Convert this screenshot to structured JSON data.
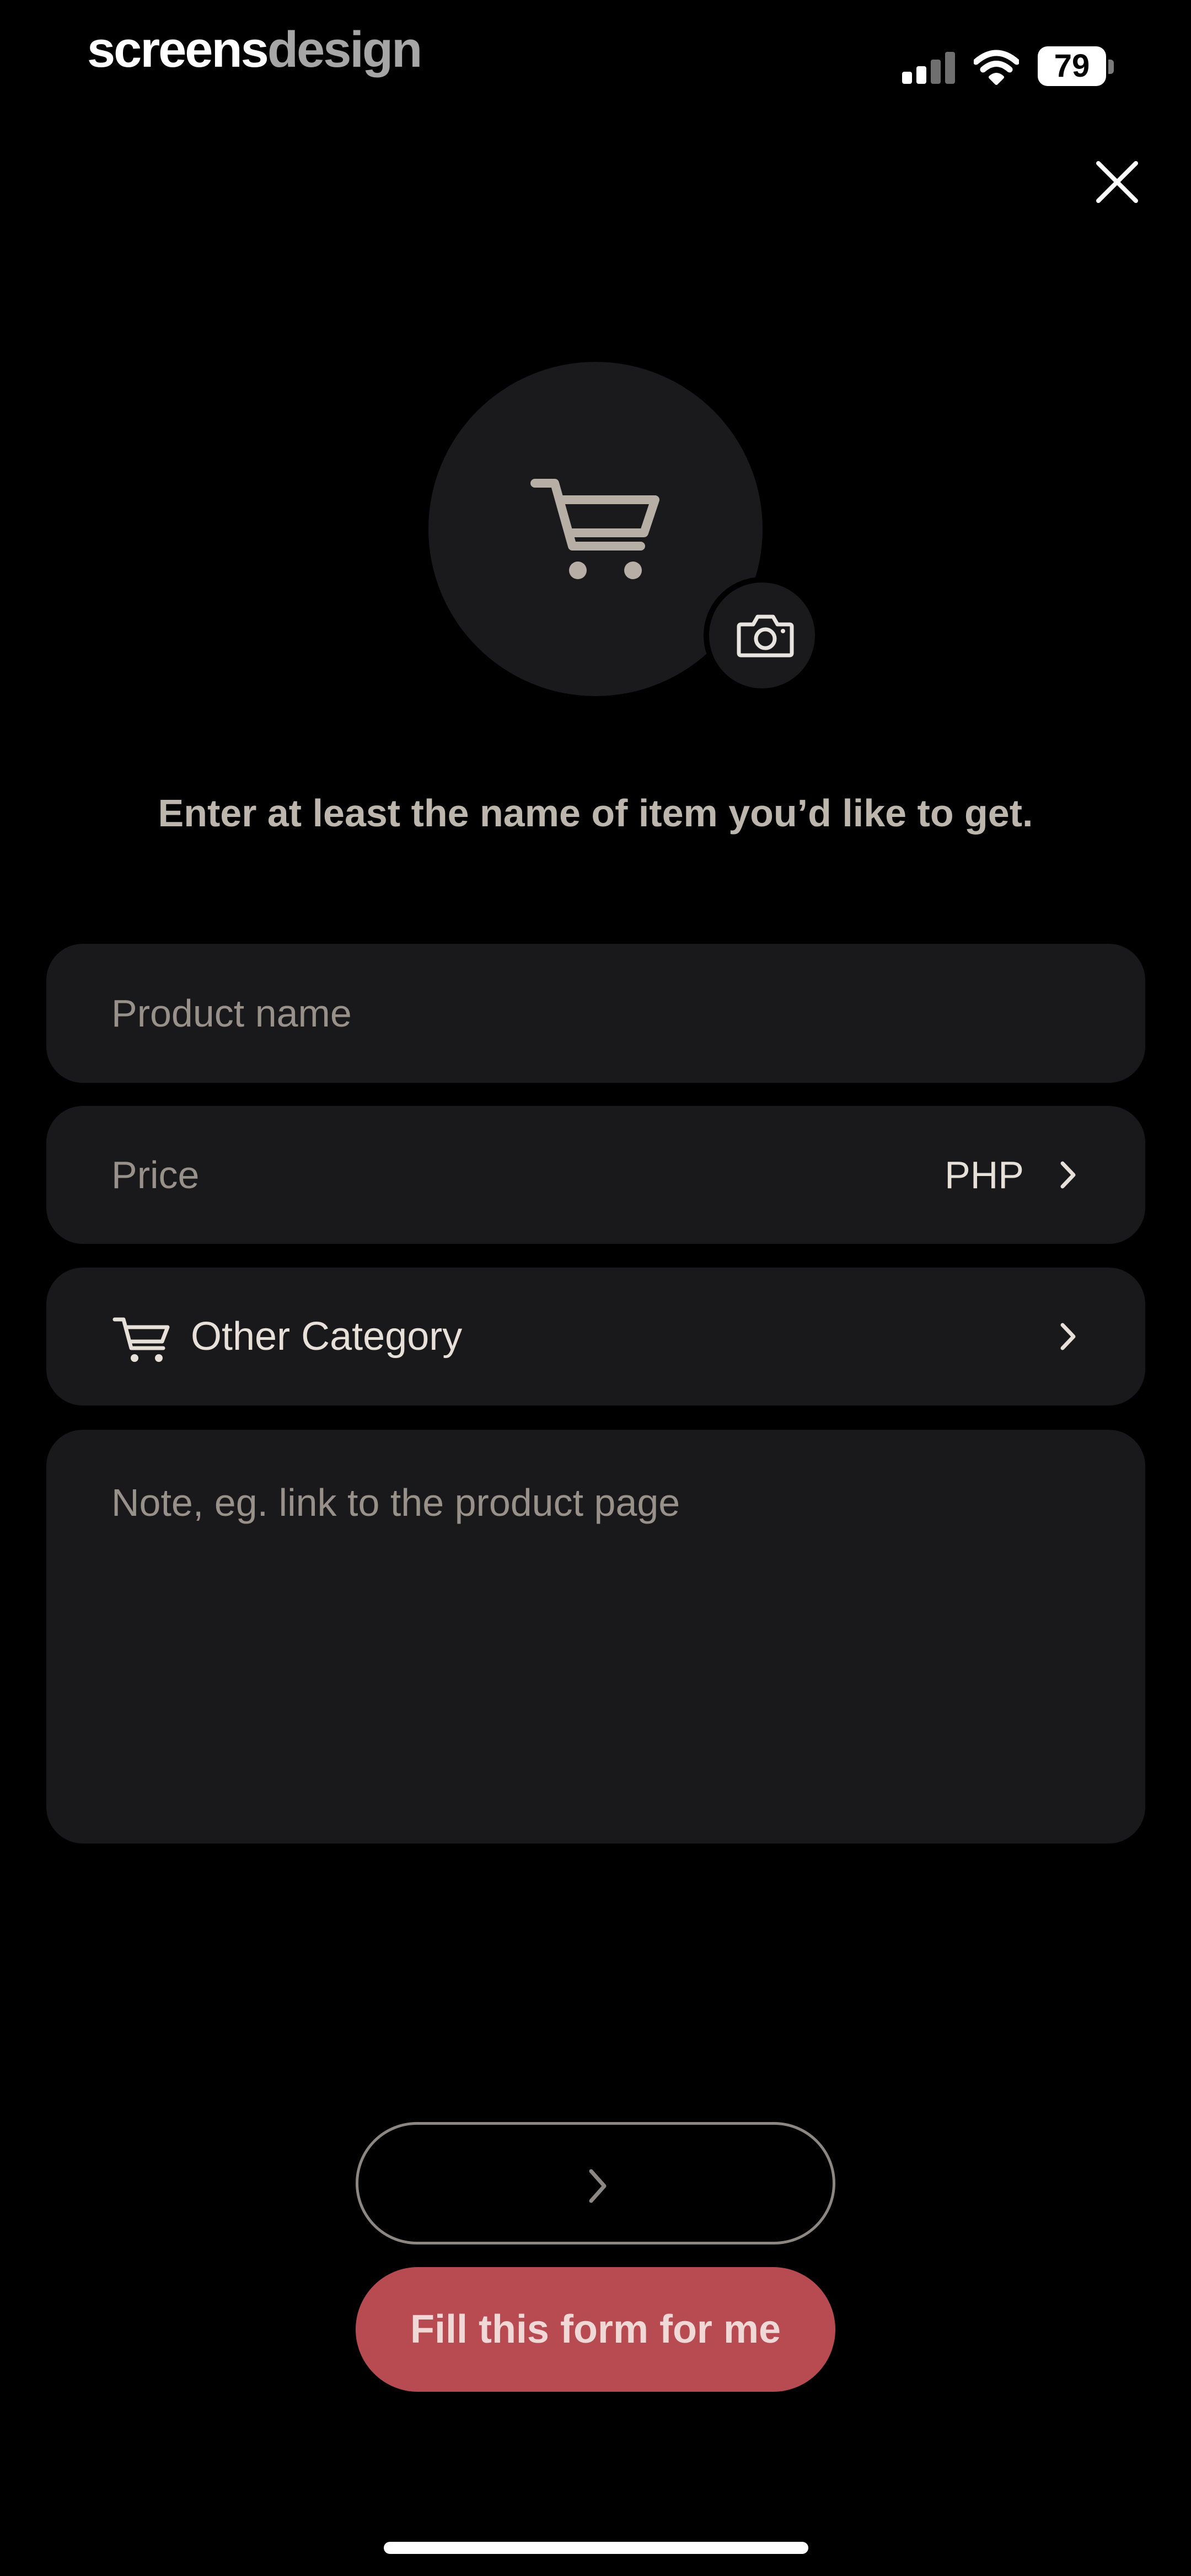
{
  "status_bar": {
    "brand_part1": "screens",
    "brand_part2": "design",
    "battery": "79"
  },
  "icons": {
    "close": "close-icon",
    "cart": "cart-icon",
    "camera": "camera-icon",
    "chevron": "chevron-right-icon"
  },
  "prompt": "Enter at least the name of item you’d like to get.",
  "form": {
    "product_name_placeholder": "Product name",
    "price_placeholder": "Price",
    "currency": "PHP",
    "category_label": "Other Category",
    "note_placeholder": "Note, eg. link to the product page"
  },
  "buttons": {
    "fill_form_label": "Fill this form for me"
  },
  "colors": {
    "background": "#000000",
    "field": "#19181a",
    "accent": "#b84b51",
    "text_muted": "#97918a"
  }
}
